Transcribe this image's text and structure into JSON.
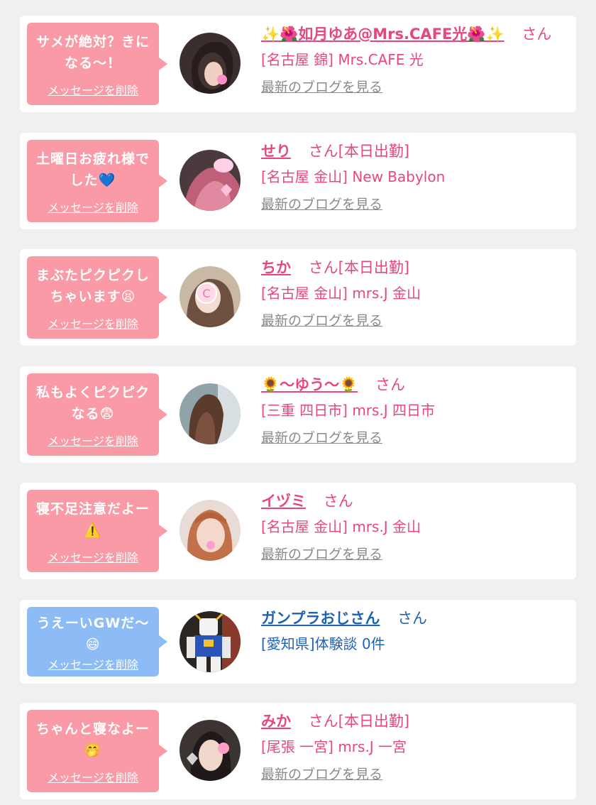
{
  "colors": {
    "page_bg": "#f0f0f0",
    "card_bg": "#ffffff",
    "bubble_pink": "#f99aa6",
    "bubble_blue": "#8dbbf5",
    "name_pink": "#e8477e",
    "name_blue": "#1d63b3",
    "blog_link": "#8a8a8a"
  },
  "common": {
    "delete_label": "メッセージを削除",
    "blog_label": "最新のブログを見る",
    "san": "さん"
  },
  "messages": [
    {
      "bubble_text": "サメが絶対？きになる〜！",
      "bubble_color": "pink",
      "name": "✨🌺如月ゆあ@Mrs.CAFE光🌺✨",
      "san_suffix": "さん",
      "shop": "[名古屋 錦] Mrs.CAFE 光",
      "has_blog": true,
      "avatar_icon": "woman-photo-icon"
    },
    {
      "bubble_text": "土曜日お疲れ様でした💙",
      "bubble_color": "pink",
      "name": "せり",
      "san_suffix": "さん[本日出勤]",
      "shop": "[名古屋 金山] New Babylon",
      "has_blog": true,
      "avatar_icon": "woman-photo-icon"
    },
    {
      "bubble_text": "まぶたピクピクしちゃいます😫",
      "bubble_color": "pink",
      "name": "ちか",
      "san_suffix": "さん[本日出勤]",
      "shop": "[名古屋 金山] mrs.J 金山",
      "has_blog": true,
      "avatar_icon": "woman-photo-icon"
    },
    {
      "bubble_text": "私もよくピクピクなる😨",
      "bubble_color": "pink",
      "name": "🌻〜ゆう〜🌻",
      "san_suffix": "さん",
      "shop": "[三重 四日市] mrs.J 四日市",
      "has_blog": true,
      "avatar_icon": "woman-photo-icon"
    },
    {
      "bubble_text": "寝不足注意だよー⚠️",
      "bubble_color": "pink",
      "name": "イヅミ",
      "san_suffix": "さん",
      "shop": "[名古屋 金山] mrs.J 金山",
      "has_blog": true,
      "avatar_icon": "woman-photo-icon"
    },
    {
      "bubble_text": "うえーいGWだ〜😄",
      "bubble_color": "blue",
      "name": "ガンプラおじさん",
      "san_suffix": "さん",
      "shop": "[愛知県]体験談 0件",
      "has_blog": false,
      "avatar_icon": "robot-model-photo-icon"
    },
    {
      "bubble_text": "ちゃんと寝なよー🤭",
      "bubble_color": "pink",
      "name": "みか",
      "san_suffix": "さん[本日出勤]",
      "shop": "[尾張 一宮] mrs.J 一宮",
      "has_blog": true,
      "avatar_icon": "woman-photo-icon"
    }
  ]
}
